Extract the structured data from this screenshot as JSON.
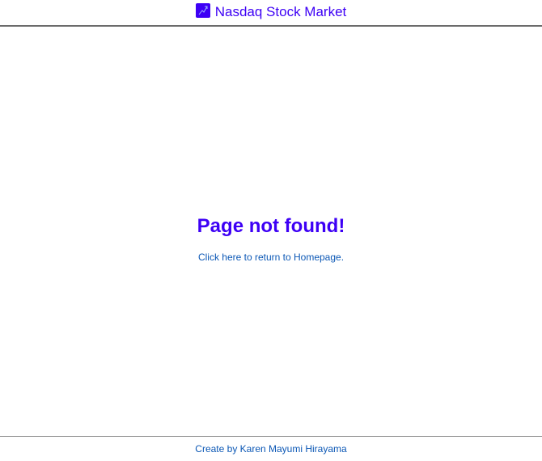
{
  "header": {
    "logo_icon": "stock-chart-icon",
    "title": "Nasdaq Stock Market",
    "accent_color": "#3d00f5"
  },
  "main": {
    "heading": "Page not found!",
    "home_link": "Click here to return to Homepage."
  },
  "footer": {
    "credit": "Create by Karen Mayumi Hirayama",
    "link_color": "#0b57b5"
  }
}
